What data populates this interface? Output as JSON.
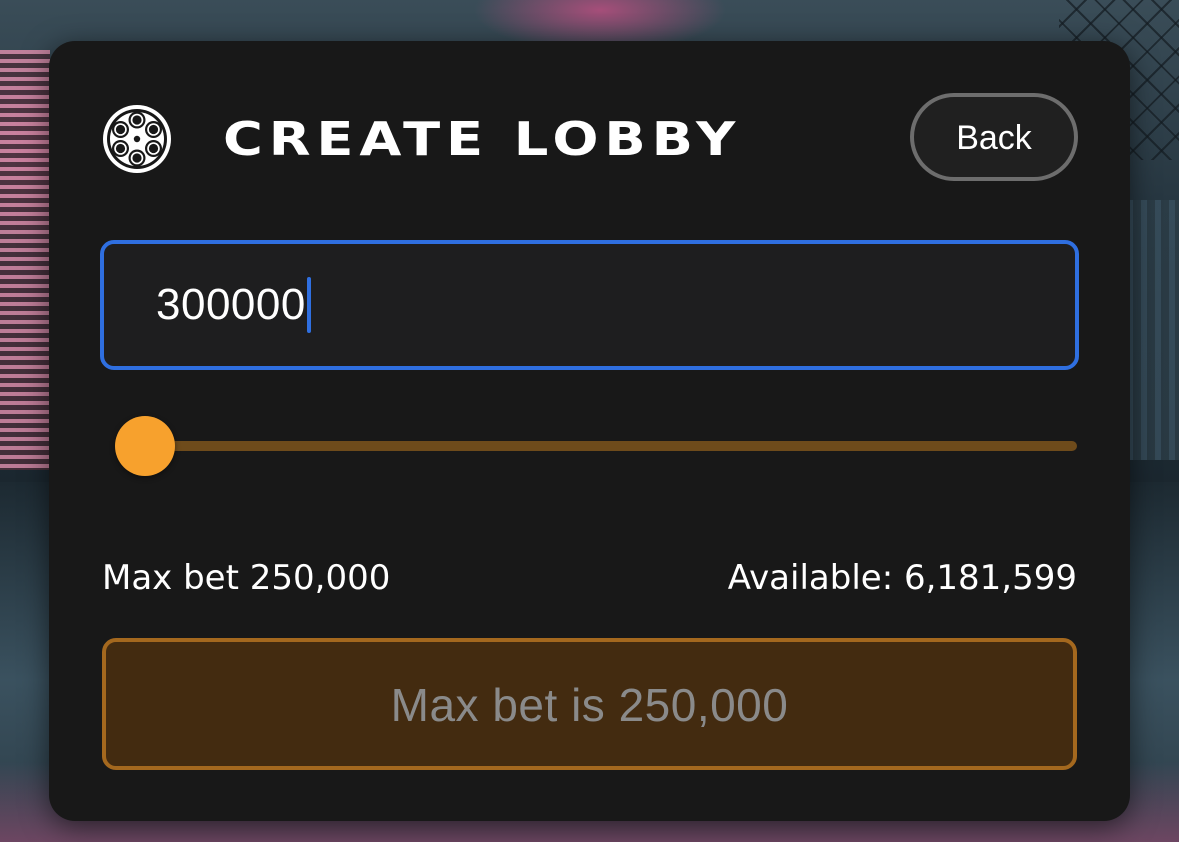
{
  "header": {
    "title": "CREATE LOBBY",
    "logo_icon": "revolver-cylinder-icon",
    "back_label": "Back"
  },
  "amount_input": {
    "value": "300000"
  },
  "slider": {
    "value_fraction": 0.0,
    "accent_color": "#f7a12d",
    "track_color": "#6e4b1b"
  },
  "info": {
    "max_bet": "Max bet 250,000",
    "available": "Available: 6,181,599"
  },
  "submit": {
    "label": "Max bet is 250,000",
    "disabled": true
  },
  "colors": {
    "card_bg": "#181818",
    "input_focus_border": "#2f6fe0",
    "submit_border": "#a4681e",
    "submit_bg": "#432b10"
  }
}
